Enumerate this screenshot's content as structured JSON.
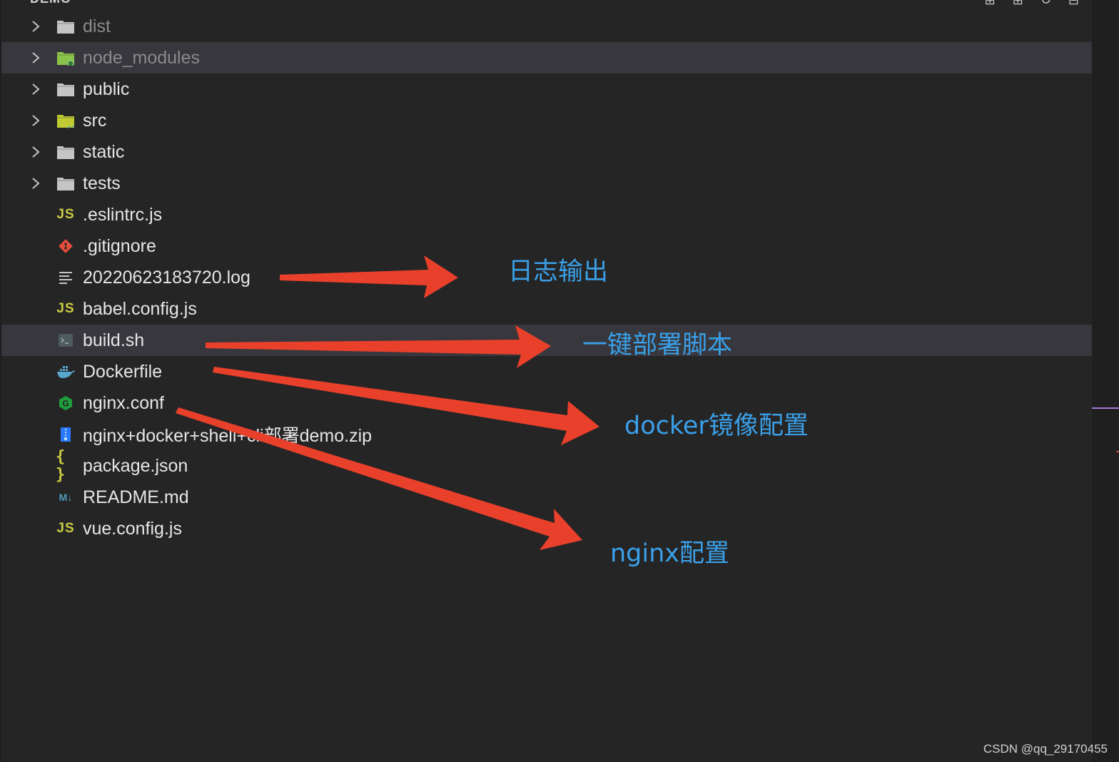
{
  "explorer": {
    "title": "DEMO",
    "items": [
      {
        "label": "dist",
        "type": "folder",
        "icon": "folder-icon",
        "icon_color": "#c5c5c5",
        "dim": true,
        "highlight": false
      },
      {
        "label": "node_modules",
        "type": "folder",
        "icon": "folder-node-icon",
        "icon_color": "#8bc34a",
        "dim": true,
        "highlight": true
      },
      {
        "label": "public",
        "type": "folder",
        "icon": "folder-icon",
        "icon_color": "#c5c5c5",
        "dim": false,
        "highlight": false
      },
      {
        "label": "src",
        "type": "folder",
        "icon": "folder-src-icon",
        "icon_color": "#c0ca33",
        "dim": false,
        "highlight": false
      },
      {
        "label": "static",
        "type": "folder",
        "icon": "folder-icon",
        "icon_color": "#c5c5c5",
        "dim": false,
        "highlight": false
      },
      {
        "label": "tests",
        "type": "folder",
        "icon": "folder-icon",
        "icon_color": "#c5c5c5",
        "dim": false,
        "highlight": false
      },
      {
        "label": ".eslintrc.js",
        "type": "file",
        "icon": "js-icon",
        "icon_text": "JS",
        "dim": false,
        "highlight": false
      },
      {
        "label": ".gitignore",
        "type": "file",
        "icon": "git-icon",
        "dim": false,
        "highlight": false
      },
      {
        "label": "20220623183720.log",
        "type": "file",
        "icon": "log-icon",
        "dim": false,
        "highlight": false
      },
      {
        "label": "babel.config.js",
        "type": "file",
        "icon": "js-icon",
        "icon_text": "JS",
        "dim": false,
        "highlight": false
      },
      {
        "label": "build.sh",
        "type": "file",
        "icon": "shell-icon",
        "dim": false,
        "highlight": true
      },
      {
        "label": "Dockerfile",
        "type": "file",
        "icon": "docker-icon",
        "dim": false,
        "highlight": false
      },
      {
        "label": "nginx.conf",
        "type": "file",
        "icon": "nginx-icon",
        "dim": false,
        "highlight": false
      },
      {
        "label": "nginx+docker+shell+cli部署demo.zip",
        "type": "file",
        "icon": "zip-icon",
        "dim": false,
        "highlight": false
      },
      {
        "label": "package.json",
        "type": "file",
        "icon": "json-icon",
        "icon_text": "{ }",
        "dim": false,
        "highlight": false
      },
      {
        "label": "README.md",
        "type": "file",
        "icon": "markdown-icon",
        "icon_text": "M↓",
        "dim": false,
        "highlight": false
      },
      {
        "label": "vue.config.js",
        "type": "file",
        "icon": "js-icon",
        "icon_text": "JS",
        "dim": false,
        "highlight": false
      }
    ]
  },
  "annotations": {
    "log_output": "日志输出",
    "one_click_deploy": "一键部署脚本",
    "docker_image_config": "docker镜像配置",
    "nginx_config": "nginx配置"
  },
  "watermark": "CSDN @qq_29170455",
  "colors": {
    "background": "#252526",
    "highlight": "#37373d",
    "arrow": "#e8402b",
    "annotation_text": "#3aa0e8"
  }
}
